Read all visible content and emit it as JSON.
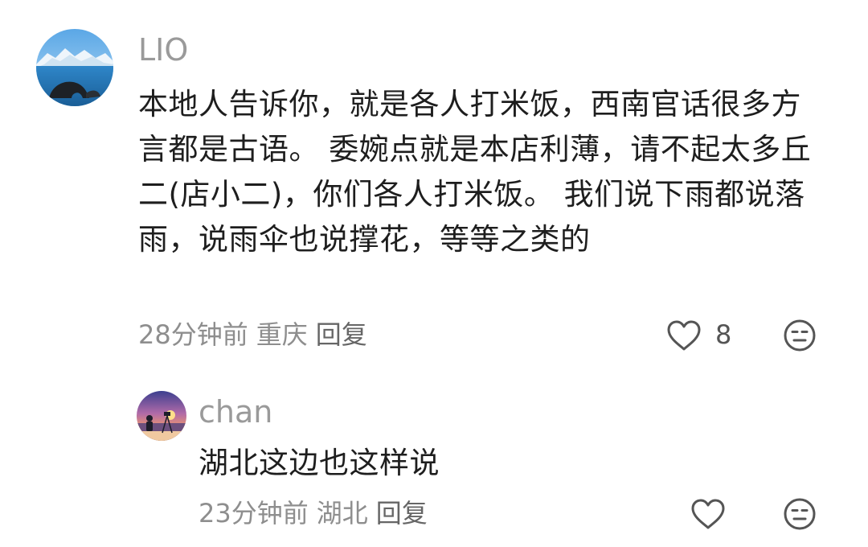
{
  "comment": {
    "username": "LIO",
    "text": "本地人告诉你，就是各人打米饭，西南官话很多方言都是古语。 委婉点就是本店利薄，请不起太多丘二(店小二)，你们各人打米饭。 我们说下雨都说落雨，说雨伞也说撑花，等等之类的",
    "time": "28分钟前",
    "location": "重庆",
    "reply_label": "回复",
    "like_count": "8",
    "like_icon": "heart-outline-icon",
    "dislike_icon": "meh-face-icon"
  },
  "reply": {
    "username": "chan",
    "text": "湖北这边也这样说",
    "time": "23分钟前",
    "location": "湖北",
    "reply_label": "回复",
    "like_icon": "heart-outline-icon",
    "dislike_icon": "meh-face-icon"
  },
  "colors": {
    "username": "#9a9a9a",
    "meta": "#8e8e8e",
    "text": "#1e1e1e",
    "icon": "#555555"
  }
}
